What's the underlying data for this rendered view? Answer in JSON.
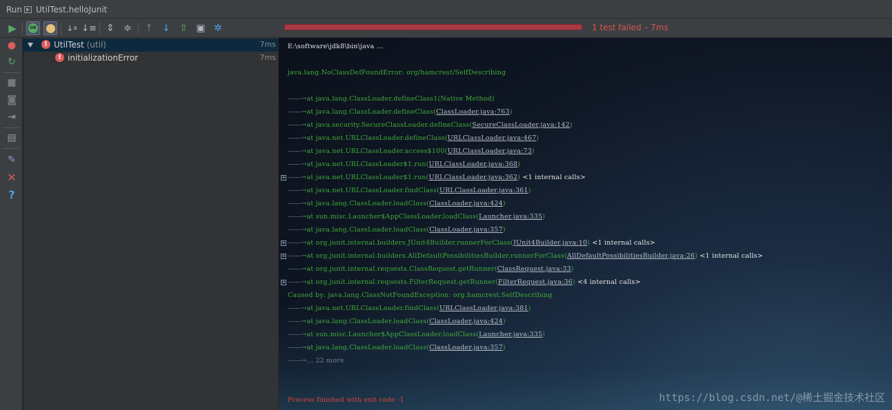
{
  "titlebar": {
    "run_label": "Run",
    "tab_title": "UtilTest.helloJunit"
  },
  "toolbar": {
    "icons": [
      "run-icon",
      "show-passed-icon",
      "show-ignored-icon",
      "sort-alpha-icon",
      "sort-duration-icon",
      "expand-all-icon",
      "collapse-all-icon",
      "prev-failed-icon",
      "next-failed-icon",
      "export-icon",
      "import-icon",
      "settings-icon"
    ],
    "progress_failed_fraction": 1.0,
    "progress_color": "#a83a46",
    "status": "1 test failed – 7ms"
  },
  "leftbar": {
    "icons": [
      "rerun-failed-icon",
      "toggle-autotest-icon",
      "stop-icon",
      "screenshot-icon",
      "exit-icon",
      "layout-icon",
      "pin-icon",
      "close-icon",
      "help-icon"
    ]
  },
  "tree": {
    "root": {
      "name": "UtilTest",
      "detail": "(util)",
      "time": "7ms"
    },
    "child": {
      "name": "initializationError",
      "time": "7ms"
    }
  },
  "console": {
    "command": "E:\\software\\jdk8\\bin\\java ...",
    "error": "java.lang.NoClassDefFoundError: org/hamcrest/SelfDescribing",
    "lines": [
      {
        "at": "at java.lang.ClassLoader.defineClass1(Native Method)",
        "link": "",
        "tail": "",
        "internal": "",
        "expand": false
      },
      {
        "at": "at java.lang.ClassLoader.defineClass(",
        "link": "ClassLoader.java:763",
        "tail": ")",
        "internal": "",
        "expand": false
      },
      {
        "at": "at java.security.SecureClassLoader.defineClass(",
        "link": "SecureClassLoader.java:142",
        "tail": ")",
        "internal": "",
        "expand": false
      },
      {
        "at": "at java.net.URLClassLoader.defineClass(",
        "link": "URLClassLoader.java:467",
        "tail": ")",
        "internal": "",
        "expand": false
      },
      {
        "at": "at java.net.URLClassLoader.access$100(",
        "link": "URLClassLoader.java:73",
        "tail": ")",
        "internal": "",
        "expand": false
      },
      {
        "at": "at java.net.URLClassLoader$1.run(",
        "link": "URLClassLoader.java:368",
        "tail": ")",
        "internal": "",
        "expand": false
      },
      {
        "at": "at java.net.URLClassLoader$1.run(",
        "link": "URLClassLoader.java:362",
        "tail": ")",
        "internal": " <1 internal calls>",
        "expand": true
      },
      {
        "at": "at java.net.URLClassLoader.findClass(",
        "link": "URLClassLoader.java:361",
        "tail": ")",
        "internal": "",
        "expand": false
      },
      {
        "at": "at java.lang.ClassLoader.loadClass(",
        "link": "ClassLoader.java:424",
        "tail": ")",
        "internal": "",
        "expand": false
      },
      {
        "at": "at sun.misc.Launcher$AppClassLoader.loadClass(",
        "link": "Launcher.java:335",
        "tail": ")",
        "internal": "",
        "expand": false
      },
      {
        "at": "at java.lang.ClassLoader.loadClass(",
        "link": "ClassLoader.java:357",
        "tail": ")",
        "internal": "",
        "expand": false
      },
      {
        "at": "at org.junit.internal.builders.JUnit4Builder.runnerForClass(",
        "link": "JUnit4Builder.java:10",
        "tail": ")",
        "internal": " <1 internal calls>",
        "expand": true
      },
      {
        "at": "at org.junit.internal.builders.AllDefaultPossibilitiesBuilder.runnerForClass(",
        "link": "AllDefaultPossibilitiesBuilder.java:26",
        "tail": ")",
        "internal": " <1 internal calls>",
        "expand": true
      },
      {
        "at": "at org.junit.internal.requests.ClassRequest.getRunner(",
        "link": "ClassRequest.java:33",
        "tail": ")",
        "internal": "",
        "expand": false
      },
      {
        "at": "at org.junit.internal.requests.FilterRequest.getRunner(",
        "link": "FilterRequest.java:36",
        "tail": ")",
        "internal": " <4 internal calls>",
        "expand": true
      }
    ],
    "caused_by": "Caused by: java.lang.ClassNotFoundException: org.hamcrest.SelfDescribing",
    "cause_lines": [
      {
        "at": "at java.net.URLClassLoader.findClass(",
        "link": "URLClassLoader.java:381",
        "tail": ")",
        "internal": "",
        "expand": false
      },
      {
        "at": "at java.lang.ClassLoader.loadClass(",
        "link": "ClassLoader.java:424",
        "tail": ")",
        "internal": "",
        "expand": false
      },
      {
        "at": "at sun.misc.Launcher$AppClassLoader.loadClass(",
        "link": "Launcher.java:335",
        "tail": ")",
        "internal": "",
        "expand": false
      },
      {
        "at": "at java.lang.ClassLoader.loadClass(",
        "link": "ClassLoader.java:357",
        "tail": ")",
        "internal": "",
        "expand": false
      }
    ],
    "more": "... 22 more",
    "exit": "Process finished with exit code -1",
    "watermark": "https://blog.csdn.net/@稀土掘金技术社区"
  }
}
